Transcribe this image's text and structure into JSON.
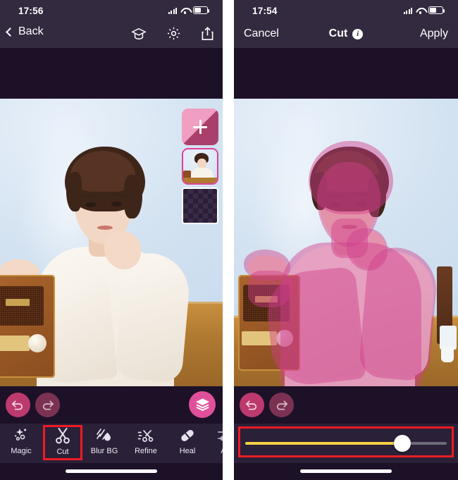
{
  "app": {
    "accent_pink": "#e0509a",
    "header_bg": "#332a3f",
    "body_bg": "#1d1128",
    "toolbar_bg": "#2a2038",
    "highlight_red": "#ee1b24",
    "slider_yellow": "#f3cf46"
  },
  "left_panel": {
    "status": {
      "time": "17:56",
      "signal_icon": "signal-bars-icon",
      "wifi_icon": "wifi-icon",
      "battery_icon": "battery-icon"
    },
    "nav": {
      "back_label": "Back",
      "back_chevron_icon": "chevron-left-icon",
      "tutorial_icon": "graduation-cap-icon",
      "settings_icon": "gear-icon",
      "share_icon": "share-upload-icon"
    },
    "layers_panel": {
      "add_layer_icon": "plus-icon",
      "photo_layer_name": "photo-layer-thumbnail",
      "transparent_layer_name": "transparent-checker-layer"
    },
    "actions": {
      "undo_icon": "undo-arrow-icon",
      "redo_icon": "redo-arrow-icon",
      "layers_icon": "layers-stack-icon",
      "undo_enabled": true,
      "redo_enabled": false
    },
    "toolbar": {
      "items": [
        {
          "label": "Magic",
          "icon": "magic-wand-icon",
          "selected": false
        },
        {
          "label": "Cut",
          "icon": "scissors-icon",
          "selected": true
        },
        {
          "label": "Blur BG",
          "icon": "blur-drop-icon",
          "selected": false
        },
        {
          "label": "Refine",
          "icon": "refine-scissors-icon",
          "selected": false
        },
        {
          "label": "Heal",
          "icon": "bandage-icon",
          "selected": false
        },
        {
          "label": "Ad",
          "icon": "adjust-sliders-icon",
          "selected": false
        }
      ]
    }
  },
  "right_panel": {
    "status": {
      "time": "17:54",
      "signal_icon": "signal-bars-icon",
      "wifi_icon": "wifi-icon",
      "battery_icon": "battery-icon"
    },
    "nav": {
      "cancel_label": "Cancel",
      "title": "Cut",
      "info_icon": "info-circle-icon",
      "info_glyph": "i",
      "apply_label": "Apply"
    },
    "actions": {
      "undo_icon": "undo-arrow-icon",
      "redo_icon": "redo-arrow-icon",
      "undo_enabled": true,
      "redo_enabled": false
    },
    "brush_slider": {
      "name": "brush-size-slider",
      "value_percent": 78,
      "min": 0,
      "max": 100
    }
  }
}
